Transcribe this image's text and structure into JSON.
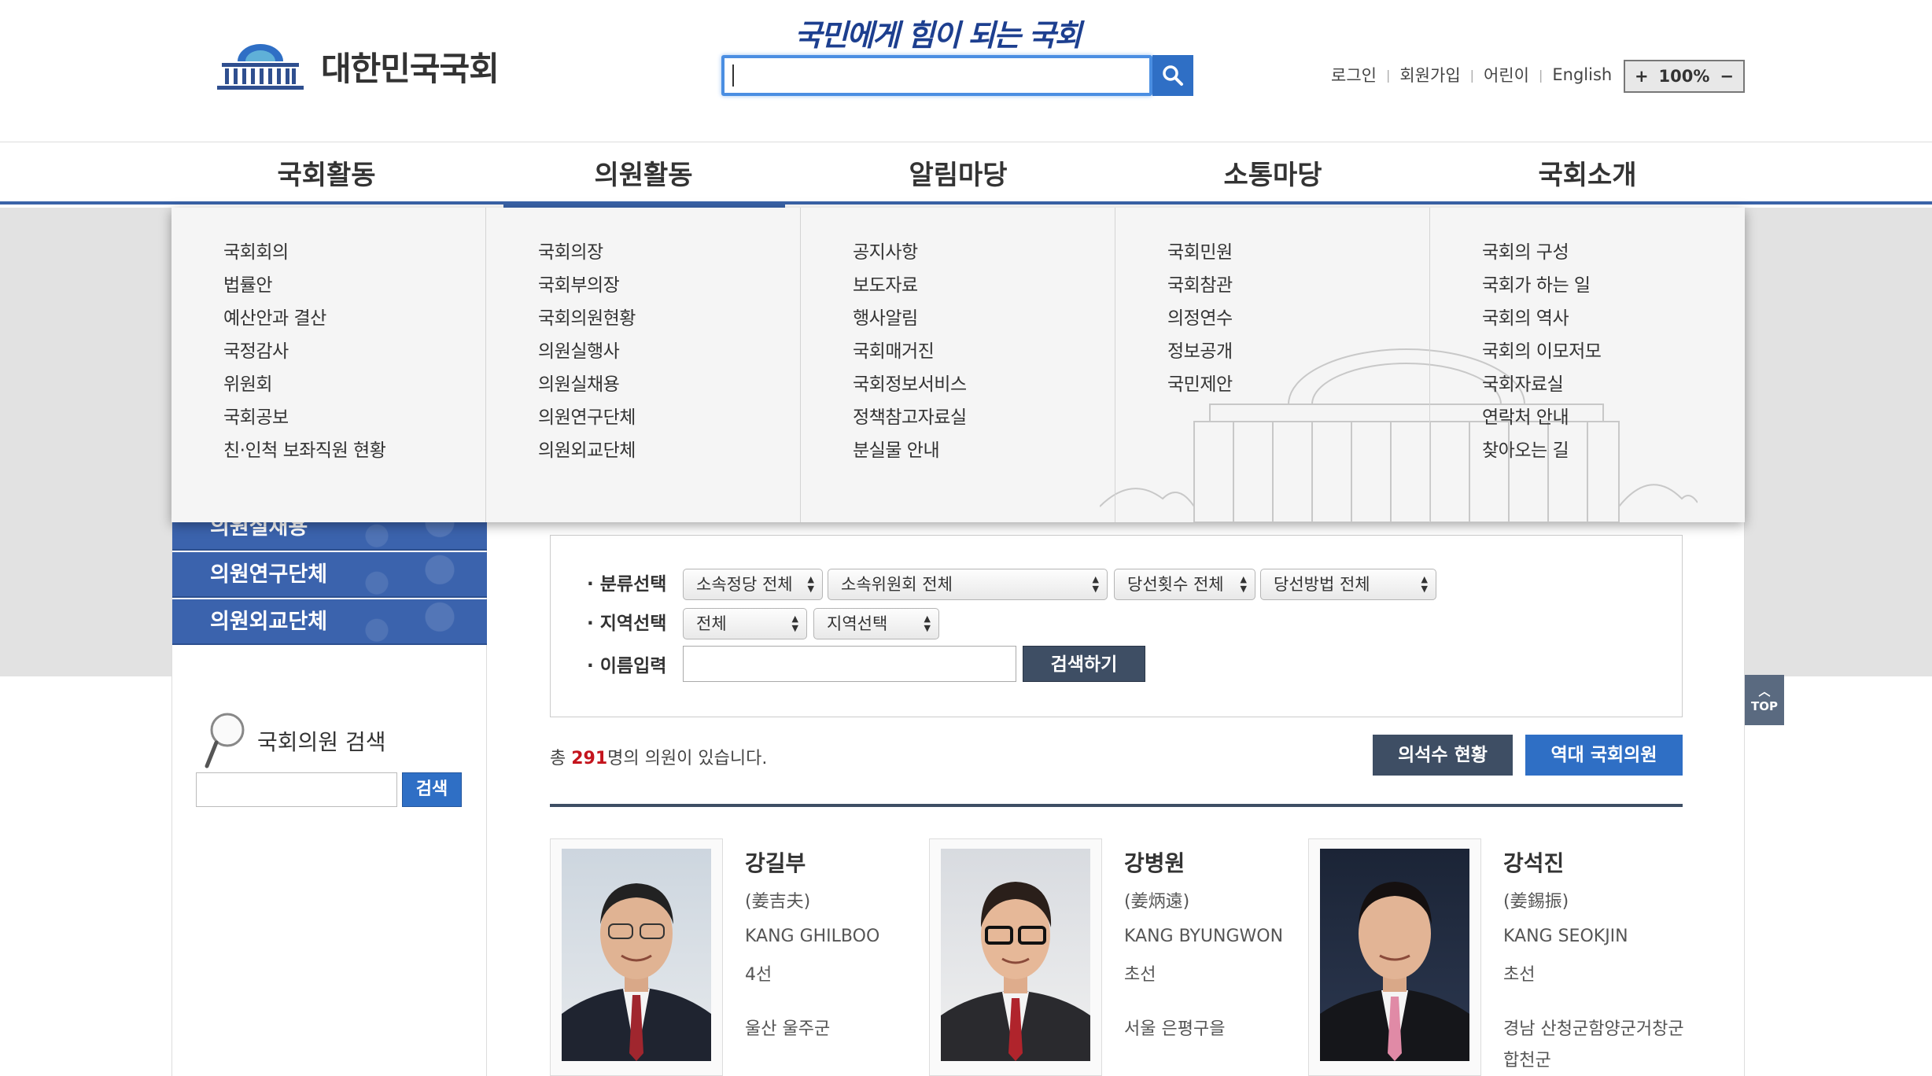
{
  "header": {
    "logo_text": "대한민국국회",
    "slogan": "국민에게 힘이 되는 국회",
    "search": {
      "value": "",
      "placeholder": ""
    },
    "util_links": [
      "로그인",
      "회원가입",
      "어린이",
      "English"
    ],
    "zoom": {
      "plus": "+",
      "level": "100%",
      "minus": "−"
    }
  },
  "gnb": [
    {
      "label": "국회활동"
    },
    {
      "label": "의원활동",
      "active": true
    },
    {
      "label": "알림마당"
    },
    {
      "label": "소통마당"
    },
    {
      "label": "국회소개"
    }
  ],
  "mega_menu": [
    [
      "국회회의",
      "법률안",
      "예산안과 결산",
      "국정감사",
      "위원회",
      "국회공보",
      "친·인척 보좌직원 현황"
    ],
    [
      "국회의장",
      "국회부의장",
      "국회의원현황",
      "의원실행사",
      "의원실채용",
      "의원연구단체",
      "의원외교단체"
    ],
    [
      "공지사항",
      "보도자료",
      "행사알림",
      "국회매거진",
      "국회정보서비스",
      "정책참고자료실",
      "분실물 안내"
    ],
    [
      "국회민원",
      "국회참관",
      "의정연수",
      "정보공개",
      "국민제안"
    ],
    [
      "국회의 구성",
      "국회가 하는 일",
      "국회의 역사",
      "국회의 이모저모",
      "국회자료실",
      "연락처 안내",
      "찾아오는 길"
    ]
  ],
  "lnb": {
    "items": [
      "의원실채용",
      "의원연구단체",
      "의원외교단체"
    ],
    "member_search_title": "국회의원 검색",
    "member_search_value": "",
    "member_search_button": "검색"
  },
  "filters": {
    "category_label": "· 분류선택",
    "party": "소속정당 전체",
    "committee": "소속위원회 전체",
    "terms": "당선횟수 전체",
    "method": "당선방법 전체",
    "region_label": "· 지역선택",
    "region_all": "전체",
    "region_select": "지역선택",
    "name_label": "· 이름입력",
    "name_value": "",
    "search_button": "검색하기"
  },
  "summary": {
    "prefix": "총 ",
    "count": "291",
    "suffix": "명의 의원이 있습니다."
  },
  "buttons": {
    "seat_status": "의석수 현황",
    "history_members": "역대 국회의원"
  },
  "members": [
    {
      "name": "강길부",
      "hanja": "(姜吉夫)",
      "english": "KANG GHILBOO",
      "terms": "4선",
      "region": "울산 울주군"
    },
    {
      "name": "강병원",
      "hanja": "(姜炳遠)",
      "english": "KANG BYUNGWON",
      "terms": "초선",
      "region": "서울 은평구을"
    },
    {
      "name": "강석진",
      "hanja": "(姜錫振)",
      "english": "KANG SEOKJIN",
      "terms": "초선",
      "region": "경남 산청군함양군거창군합천군"
    }
  ],
  "top_button": "TOP",
  "colors": {
    "accent_blue": "#2f6fc5",
    "nav_blue": "#3b63ad",
    "dark_button": "#3e4e64",
    "count_red": "#c4141d"
  }
}
